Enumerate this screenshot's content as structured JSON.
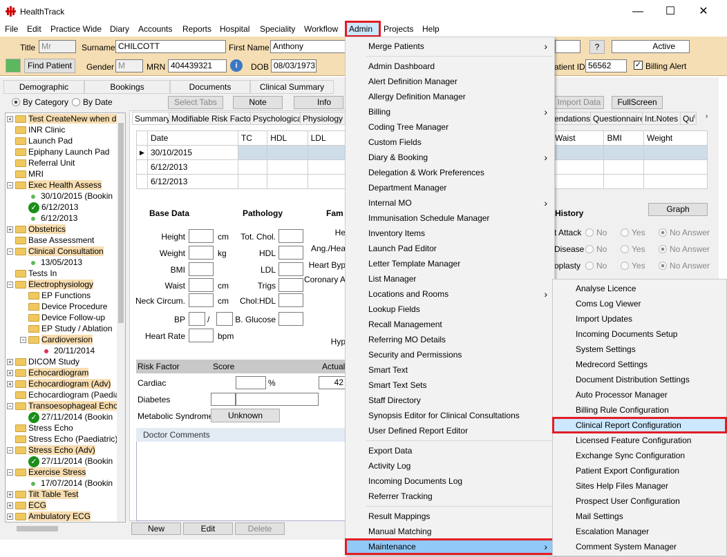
{
  "window": {
    "title": "HealthTrack",
    "min": "—",
    "max": "☐",
    "close": "✕"
  },
  "menubar": [
    "File",
    "Edit",
    "Practice Wide",
    "Diary",
    "Accounts",
    "Reports",
    "Hospital",
    "Speciality",
    "Workflow",
    "Admin",
    "Projects",
    "Help"
  ],
  "patient": {
    "title_label": "Title",
    "title_value": "Mr",
    "surname_label": "Surname",
    "surname": "CHILCOTT",
    "firstname_label": "First Name",
    "firstname": "Anthony",
    "find_patient": "Find Patient",
    "gender_label": "Gender",
    "gender": "M",
    "mrn_label": "MRN",
    "mrn": "404439321",
    "dob_label": "DOB",
    "dob": "08/03/1973",
    "patient_id_label": "atient ID",
    "patient_id": "56562",
    "billing_alert": "Billing Alert",
    "status": "Active",
    "help_btn": "?"
  },
  "main_tabs": [
    "Demographic",
    "Bookings",
    "Documents",
    "Clinical Summary"
  ],
  "filter": {
    "by_category": "By Category",
    "by_date": "By Date"
  },
  "toolbar": {
    "select_tabs": "Select Tabs",
    "note": "Note",
    "info": "Info",
    "import_data": "Import Data",
    "fullscreen": "FullScreen",
    "graph": "Graph"
  },
  "tree": [
    {
      "text": "Test CreateNew when di",
      "hl": true,
      "type": "folder",
      "indent": 0,
      "pm": "+"
    },
    {
      "text": "INR Clinic",
      "type": "folder",
      "indent": 0
    },
    {
      "text": "Launch Pad",
      "type": "folder",
      "indent": 0
    },
    {
      "text": "Epiphany Launch Pad",
      "type": "folder",
      "indent": 0
    },
    {
      "text": "Referral Unit",
      "type": "folder",
      "indent": 0
    },
    {
      "text": "MRI",
      "type": "folder",
      "indent": 0
    },
    {
      "text": "Exec Health Assess",
      "hl": true,
      "type": "folder",
      "indent": 0,
      "pm": "−"
    },
    {
      "text": "30/10/2015 (Bookin",
      "type": "dot",
      "indent": 1
    },
    {
      "text": "6/12/2013",
      "type": "check",
      "indent": 1
    },
    {
      "text": "6/12/2013",
      "type": "dot",
      "indent": 1
    },
    {
      "text": "Obstetrics",
      "hl": true,
      "type": "folder",
      "indent": 0,
      "pm": "+"
    },
    {
      "text": "Base Assessment",
      "type": "folder",
      "indent": 0
    },
    {
      "text": "Clinical Consultation",
      "hl": true,
      "type": "folder",
      "indent": 0,
      "pm": "−"
    },
    {
      "text": "13/05/2013",
      "type": "dot",
      "indent": 1
    },
    {
      "text": "Tests In",
      "type": "folder",
      "indent": 0
    },
    {
      "text": "Electrophysiology",
      "hl": true,
      "type": "folder",
      "indent": 0,
      "pm": "−"
    },
    {
      "text": "EP Functions",
      "type": "folder",
      "indent": 1
    },
    {
      "text": "Device Procedure",
      "type": "folder",
      "indent": 1
    },
    {
      "text": "Device Follow-up",
      "type": "folder",
      "indent": 1
    },
    {
      "text": "EP Study / Ablation",
      "type": "folder",
      "indent": 1
    },
    {
      "text": "Cardioversion",
      "hl": true,
      "type": "folder",
      "indent": 1,
      "pm": "−"
    },
    {
      "text": "20/11/2014",
      "type": "reddot",
      "indent": 2
    },
    {
      "text": "DICOM Study",
      "type": "folder",
      "indent": 0,
      "pm": "+"
    },
    {
      "text": "Echocardiogram",
      "hl": true,
      "type": "folder",
      "indent": 0,
      "pm": "+"
    },
    {
      "text": "Echocardiogram (Adv)",
      "hl": true,
      "type": "folder",
      "indent": 0,
      "pm": "+"
    },
    {
      "text": "Echocardiogram (Paedia",
      "type": "folder",
      "indent": 0
    },
    {
      "text": "Transoesophageal Echo",
      "hl": true,
      "type": "folder",
      "indent": 0,
      "pm": "−"
    },
    {
      "text": "27/11/2014 (Bookin",
      "type": "check",
      "indent": 1
    },
    {
      "text": "Stress Echo",
      "type": "folder",
      "indent": 0
    },
    {
      "text": "Stress Echo (Paediatric)",
      "type": "folder",
      "indent": 0
    },
    {
      "text": "Stress Echo (Adv)",
      "hl": true,
      "type": "folder",
      "indent": 0,
      "pm": "−"
    },
    {
      "text": "27/11/2014 (Bookin",
      "type": "check",
      "indent": 1
    },
    {
      "text": "Exercise Stress",
      "hl": true,
      "type": "folder",
      "indent": 0,
      "pm": "−"
    },
    {
      "text": "17/07/2014 (Bookin",
      "type": "dot",
      "indent": 1
    },
    {
      "text": "Tilt Table Test",
      "hl": true,
      "type": "folder",
      "indent": 0,
      "pm": "+"
    },
    {
      "text": "ECG",
      "hl": true,
      "type": "folder",
      "indent": 0,
      "pm": "+"
    },
    {
      "text": "Ambulatory ECG",
      "hl": true,
      "type": "folder",
      "indent": 0,
      "pm": "+"
    }
  ],
  "sub_tabs": [
    "Summary",
    "Modifiable Risk Factors",
    "Psychological",
    "Physiology /"
  ],
  "sub_tabs_right": [
    "endations",
    "Questionnaire",
    "Int.Notes",
    "Qu"
  ],
  "grid": {
    "headers": [
      "Date",
      "TC",
      "HDL",
      "LDL"
    ],
    "rows": [
      "30/10/2015",
      "6/12/2013",
      "6/12/2013"
    ],
    "right_headers": [
      "Waist",
      "BMI",
      "Weight"
    ]
  },
  "base_data": {
    "title": "Base Data",
    "fields": [
      "Height",
      "Weight",
      "BMI",
      "Waist",
      "Neck Circum.",
      "BP",
      "Heart Rate"
    ],
    "units": [
      "cm",
      "kg",
      "",
      "cm",
      "cm",
      "/",
      "bpm"
    ]
  },
  "pathology": {
    "title": "Pathology",
    "fields": [
      "Tot. Chol.",
      "HDL",
      "LDL",
      "Trigs",
      "Chol:HDL",
      "B. Glucose"
    ]
  },
  "family": {
    "title": "Fam",
    "fields": [
      "He",
      "Ang./Hea",
      "Heart Byp",
      "Coronary A",
      "Hyp"
    ]
  },
  "history": {
    "title": "History",
    "rows": [
      "t Attack",
      "Disease",
      "oplasty"
    ],
    "no": "No",
    "yes": "Yes",
    "no_answer": "No Answer"
  },
  "risk": {
    "headers": [
      "Risk Factor",
      "Score",
      "Actual"
    ],
    "rows": [
      "Cardiac",
      "Diabetes",
      "Metabolic Syndrome"
    ],
    "cardiac_unit": "%",
    "cardiac_actual": "42",
    "metabolic": "Unknown"
  },
  "doctor_comments": "Doctor Comments",
  "bottom_btns": [
    "New",
    "Edit",
    "Delete"
  ],
  "admin_menu": [
    "Merge Patients",
    "Admin Dashboard",
    "Alert Definition Manager",
    "Allergy Definition Manager",
    "Billing",
    "Coding Tree Manager",
    "Custom Fields",
    "Diary & Booking",
    "Delegation & Work Preferences",
    "Department Manager",
    "Internal MO",
    "Immunisation Schedule Manager",
    "Inventory Items",
    "Launch Pad Editor",
    "Letter Template Manager",
    "List Manager",
    "Locations and Rooms",
    "Lookup Fields",
    "Recall Management",
    "Referring MO Details",
    "Security and Permissions",
    "Smart Text",
    "Smart Text Sets",
    "Staff Directory",
    "Synopsis Editor for Clinical Consultations",
    "User Defined Report Editor",
    "Export Data",
    "Activity Log",
    "Incoming Documents Log",
    "Referrer Tracking",
    "Result Mappings",
    "Manual Matching",
    "Maintenance"
  ],
  "maintenance_menu": [
    "Analyse Licence",
    "Coms Log Viewer",
    "Import Updates",
    "Incoming Documents Setup",
    "System Settings",
    "Medrecord Settings",
    "Document Distribution Settings",
    "Auto Processor Manager",
    "Billing Rule Configuration",
    "Clinical Report Configuration",
    "Licensed Feature Configuration",
    "Exchange Sync Configuration",
    "Patient Export Configuration",
    "Sites Help Files Manager",
    "Prospect User Configuration",
    "Mail Settings",
    "Escalation Manager",
    "Comment System Manager"
  ],
  "colors": {
    "highlight_red": "#e31c25",
    "menu_selected": "#cce8ff",
    "patient_bar": "#f5deb3"
  }
}
